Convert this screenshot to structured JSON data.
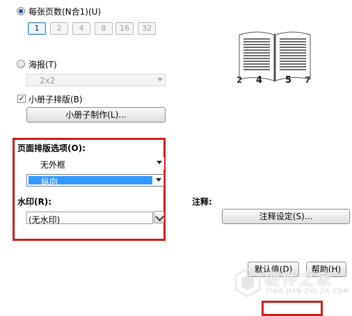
{
  "pages_per_sheet": {
    "label": "每张页数(N合1)(U)",
    "options": [
      "1",
      "2",
      "4",
      "8",
      "16",
      "32"
    ],
    "selected": "1"
  },
  "poster": {
    "label": "海报(T)",
    "size_value": "2x2"
  },
  "booklet": {
    "checkbox_label": "小册子排版(B)",
    "make_button": "小册子制作(L)..."
  },
  "preview_page_numbers": [
    "2",
    "4",
    "5",
    "7"
  ],
  "layout_options": {
    "label": "页面排版选项(O):",
    "border_value": "无外框",
    "orientation_value": "纵向"
  },
  "watermark": {
    "label": "水印(R):",
    "value": "(无水印)"
  },
  "annotation": {
    "label": "注释:",
    "settings_button": "注释设定(S)..."
  },
  "footer": {
    "default_button": "默认值(D)",
    "help_button": "帮助(H)"
  },
  "watermark_logo": {
    "cn": "硬件之家",
    "en": "YING JIAN ZHI JIA.COM"
  },
  "colors": {
    "highlight_red": "#d01c1c",
    "selection_blue": "#3399ff"
  }
}
